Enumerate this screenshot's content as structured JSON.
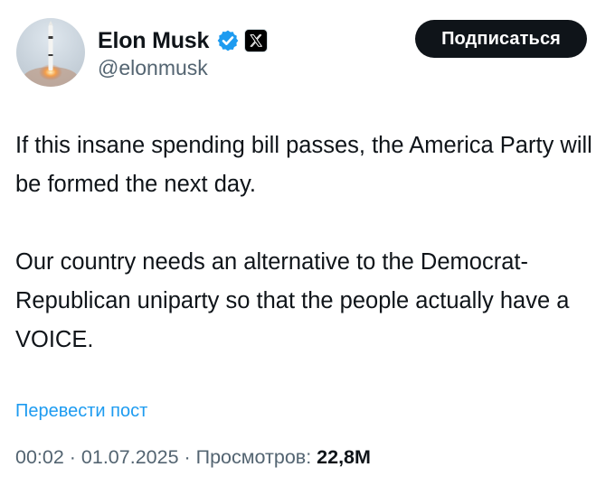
{
  "author": {
    "display_name": "Elon Musk",
    "handle": "@elonmusk",
    "verified_icon": "verified-badge-icon",
    "affiliate_icon": "x-logo-icon",
    "verified_color": "#1d9bf0"
  },
  "follow_button": {
    "label": "Подписаться"
  },
  "tweet": {
    "paragraph_1": "If this insane spending bill passes, the America Party will be formed the next day.",
    "paragraph_2": "Our country needs an alternative to the Democrat-Republican uniparty so that the people actually have a VOICE."
  },
  "translate": {
    "label": "Перевести пост"
  },
  "meta": {
    "time": "00:02",
    "separator_1": " · ",
    "date": "01.07.2025",
    "separator_2": " · ",
    "views_label": "Просмотров: ",
    "views_count": "22,8M"
  },
  "colors": {
    "text": "#0f1419",
    "secondary": "#536471",
    "link": "#1d9bf0",
    "button_bg": "#0f1419"
  }
}
